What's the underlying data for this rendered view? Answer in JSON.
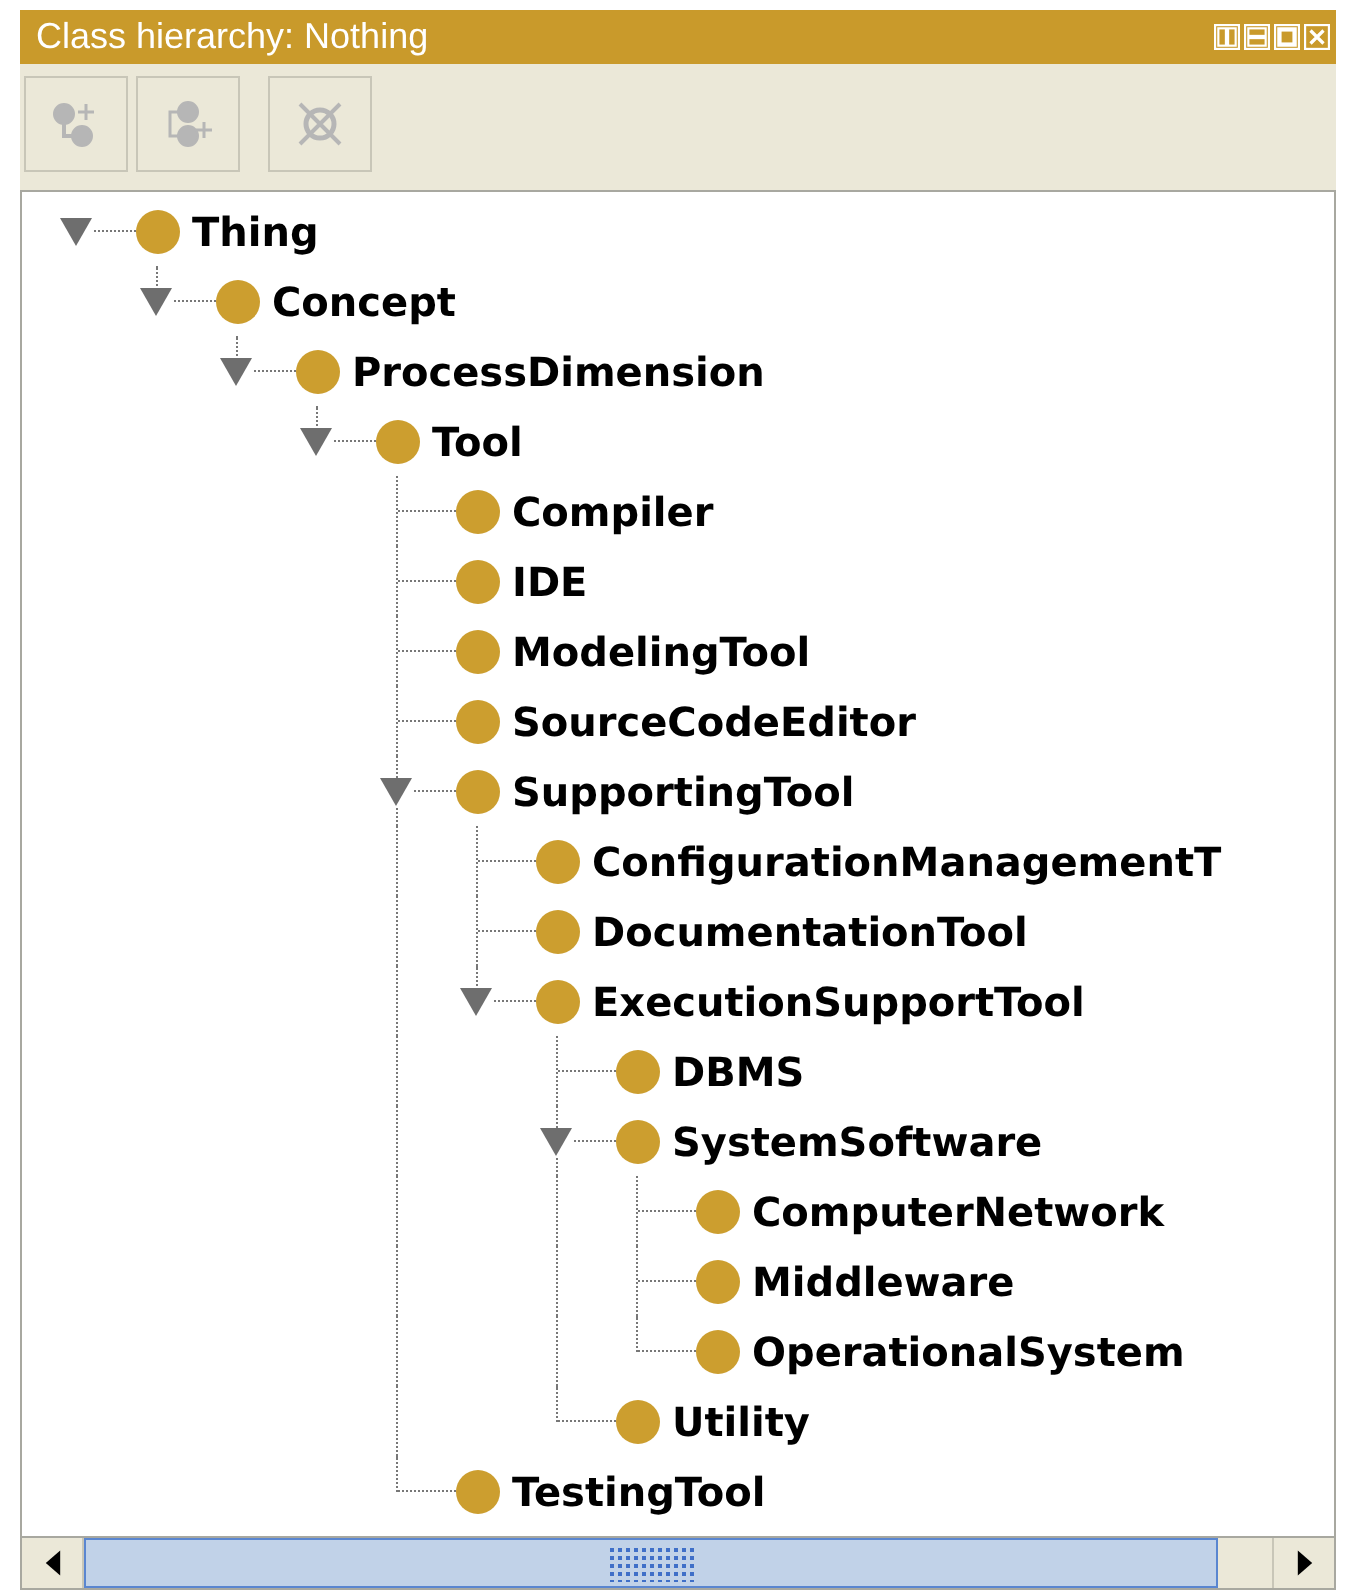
{
  "window": {
    "title": "Class hierarchy: Nothing"
  },
  "toolbar": [
    {
      "kind": "add-subclass",
      "disabled": true
    },
    {
      "kind": "add-sibling",
      "disabled": true
    },
    {
      "kind": "delete",
      "disabled": true
    }
  ],
  "tree": [
    {
      "label": "Thing",
      "expanded": true,
      "children": [
        {
          "label": "Concept",
          "expanded": true,
          "children": [
            {
              "label": "ProcessDimension",
              "expanded": true,
              "children": [
                {
                  "label": "Tool",
                  "expanded": true,
                  "children": [
                    {
                      "label": "Compiler"
                    },
                    {
                      "label": "IDE"
                    },
                    {
                      "label": "ModelingTool"
                    },
                    {
                      "label": "SourceCodeEditor"
                    },
                    {
                      "label": "SupportingTool",
                      "expanded": true,
                      "children": [
                        {
                          "label": "ConfigurationManagementT"
                        },
                        {
                          "label": "DocumentationTool"
                        },
                        {
                          "label": "ExecutionSupportTool",
                          "expanded": true,
                          "children": [
                            {
                              "label": "DBMS"
                            },
                            {
                              "label": "SystemSoftware",
                              "expanded": true,
                              "children": [
                                {
                                  "label": "ComputerNetwork"
                                },
                                {
                                  "label": "Middleware"
                                },
                                {
                                  "label": "OperationalSystem"
                                }
                              ]
                            },
                            {
                              "label": "Utility"
                            }
                          ]
                        }
                      ]
                    },
                    {
                      "label": "TestingTool"
                    }
                  ]
                }
              ]
            }
          ]
        }
      ]
    }
  ]
}
